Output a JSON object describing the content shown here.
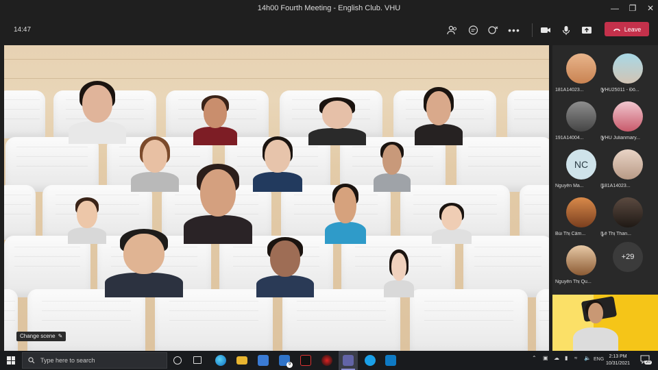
{
  "window": {
    "title": "14h00 Fourth Meeting - English Club. VHU"
  },
  "toolbar": {
    "time": "14:47",
    "leave_label": "Leave"
  },
  "stage": {
    "change_scene_label": "Change scene"
  },
  "participants": [
    {
      "name": "181A14023...",
      "avatar": "photo"
    },
    {
      "name": "VHU25011 - Đỗ...",
      "avatar": "photo"
    },
    {
      "name": "191A14004...",
      "avatar": "photo"
    },
    {
      "name": "VHU Julianmary...",
      "avatar": "photo"
    },
    {
      "name": "Nguyễn Ma...",
      "avatar": "NC"
    },
    {
      "name": "181A14023...",
      "avatar": "photo"
    },
    {
      "name": "Bùi Thị Cẩm...",
      "avatar": "photo"
    },
    {
      "name": "Lê Thị Than...",
      "avatar": "photo"
    },
    {
      "name": "Nguyễn Thị Qu...",
      "avatar": "photo"
    }
  ],
  "more_participants": "+29",
  "taskbar": {
    "search_placeholder": "Type here to search",
    "language": "ENG",
    "time": "2:13 PM",
    "date": "10/31/2021",
    "notification_count": "20",
    "mail_badge": "9"
  },
  "colors": {
    "leave": "#c4314b",
    "selfview_bg": "#f5c518",
    "taskbar": "#191b1e"
  }
}
